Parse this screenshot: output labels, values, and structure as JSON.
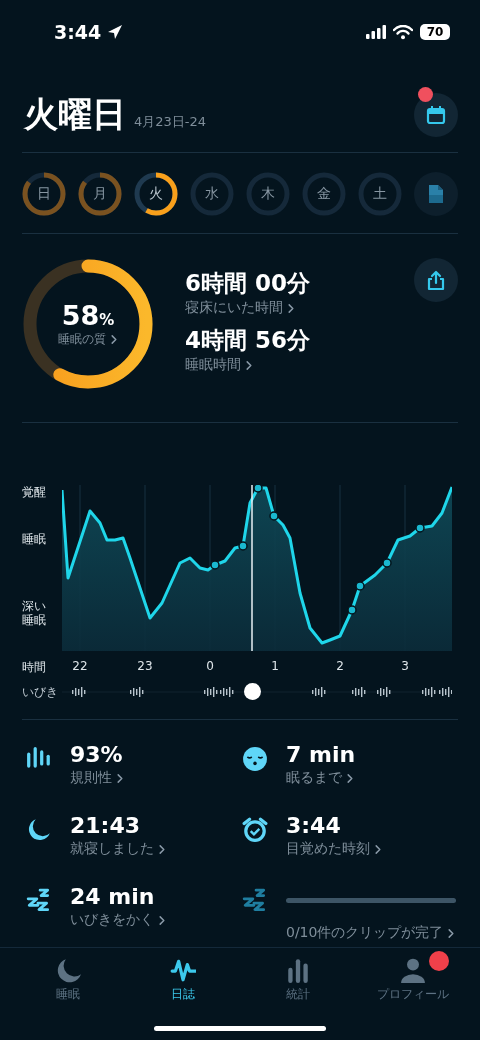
{
  "status_bar": {
    "time": "3:44",
    "battery": "70"
  },
  "header": {
    "title": "火曜日",
    "date_range": "4月23日-24",
    "calendar_badge": true
  },
  "days": [
    {
      "label": "日",
      "recorded": true,
      "selected": false
    },
    {
      "label": "月",
      "recorded": true,
      "selected": false
    },
    {
      "label": "火",
      "recorded": true,
      "selected": true
    },
    {
      "label": "水",
      "recorded": false,
      "selected": false
    },
    {
      "label": "木",
      "recorded": false,
      "selected": false
    },
    {
      "label": "金",
      "recorded": false,
      "selected": false
    },
    {
      "label": "土",
      "recorded": false,
      "selected": false
    }
  ],
  "summary": {
    "quality": {
      "value": "58",
      "unit": "%",
      "label": "睡眠の質"
    },
    "metrics": [
      {
        "value": "6時間 00分",
        "label": "寝床にいた時間"
      },
      {
        "value": "4時間 56分",
        "label": "睡眠時間"
      }
    ]
  },
  "hypnogram": {
    "stages": [
      "覚醒",
      "睡眠",
      "深い睡眠"
    ],
    "time_label": "時間",
    "hours": [
      "22",
      "23",
      "0",
      "1",
      "2",
      "3"
    ],
    "snore_label": "いびき"
  },
  "stats": [
    {
      "kind": "value",
      "value": "93%",
      "label": "規則性"
    },
    {
      "kind": "value",
      "value": "7 min",
      "label": "眠るまで"
    },
    {
      "kind": "value",
      "value": "21:43",
      "label": "就寝しました"
    },
    {
      "kind": "value",
      "value": "3:44",
      "label": "目覚めた時刻"
    },
    {
      "kind": "value",
      "value": "24 min",
      "label": "いびきをかく"
    },
    {
      "kind": "progress",
      "level": 0,
      "label": "0/10件のクリップが完了"
    }
  ],
  "tabs": [
    {
      "label": "睡眠",
      "selected": false,
      "badge": false
    },
    {
      "label": "日誌",
      "selected": true,
      "badge": false
    },
    {
      "label": "統計",
      "selected": false,
      "badge": false
    },
    {
      "label": "プロフィール",
      "selected": false,
      "badge": true
    }
  ]
}
